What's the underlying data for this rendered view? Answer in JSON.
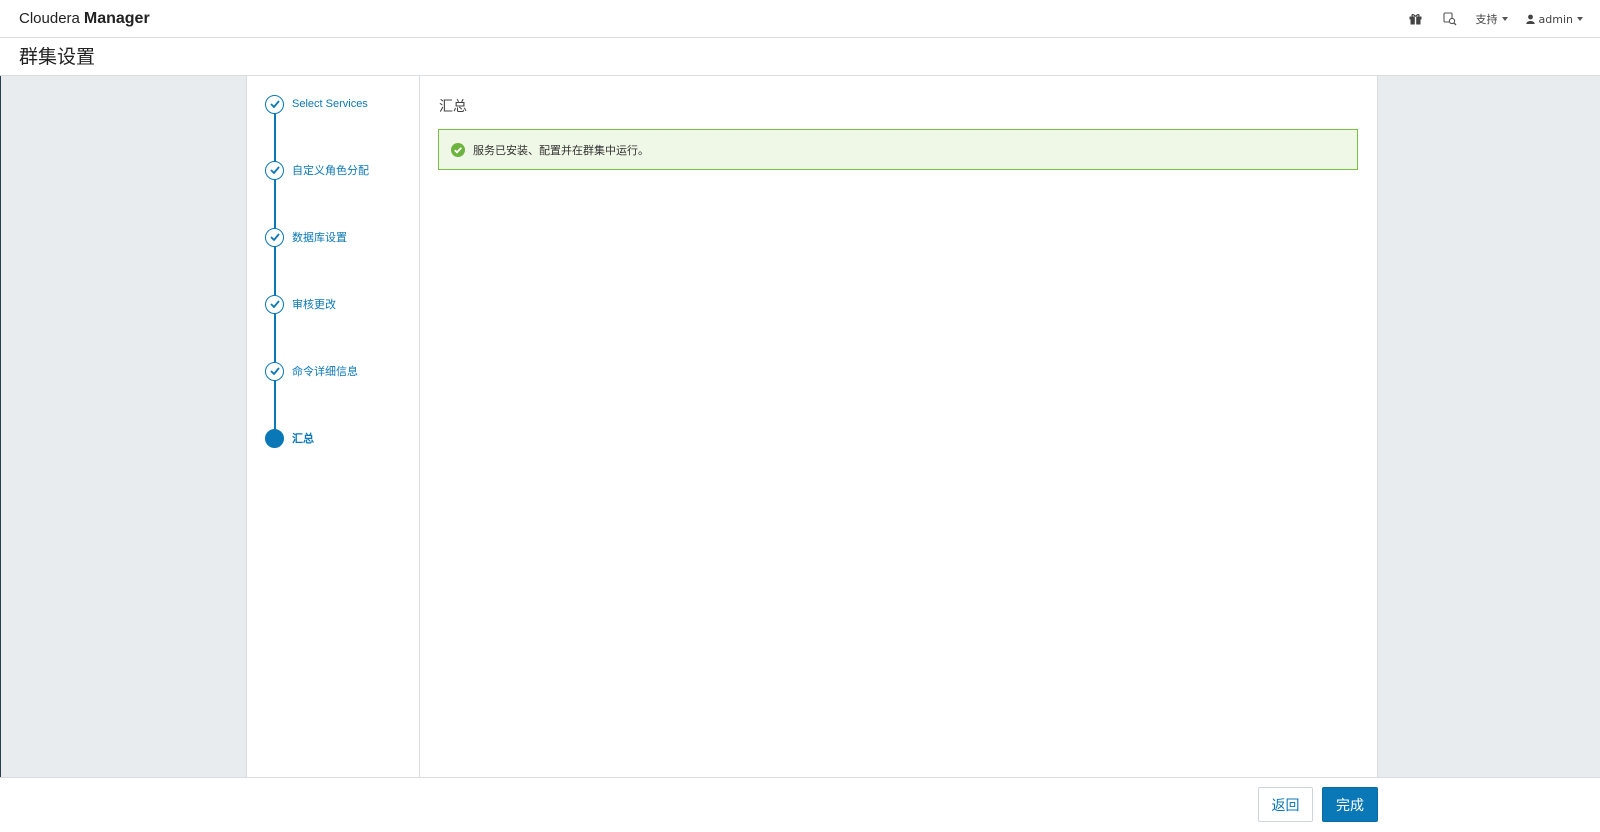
{
  "app": {
    "brand_light": "Cloudera",
    "brand_bold": "Manager"
  },
  "navbar": {
    "support_label": "支持",
    "user_label": "admin",
    "icons": [
      "gift-icon",
      "search-hosts-icon"
    ]
  },
  "page": {
    "title": "群集设置"
  },
  "wizard": {
    "steps": [
      {
        "label": "Select Services",
        "state": "completed"
      },
      {
        "label": "自定义角色分配",
        "state": "completed"
      },
      {
        "label": "数据库设置",
        "state": "completed"
      },
      {
        "label": "审核更改",
        "state": "completed"
      },
      {
        "label": "命令详细信息",
        "state": "completed"
      },
      {
        "label": "汇总",
        "state": "active"
      }
    ],
    "section_title": "汇总",
    "alert_text": "服务已安装、配置并在群集中运行。"
  },
  "footer": {
    "back_label": "返回",
    "finish_label": "完成"
  },
  "colors": {
    "primary": "#0a78b6",
    "success": "#7ac142",
    "success_bg": "#eff7e6",
    "body_bg": "#e8ecef"
  }
}
